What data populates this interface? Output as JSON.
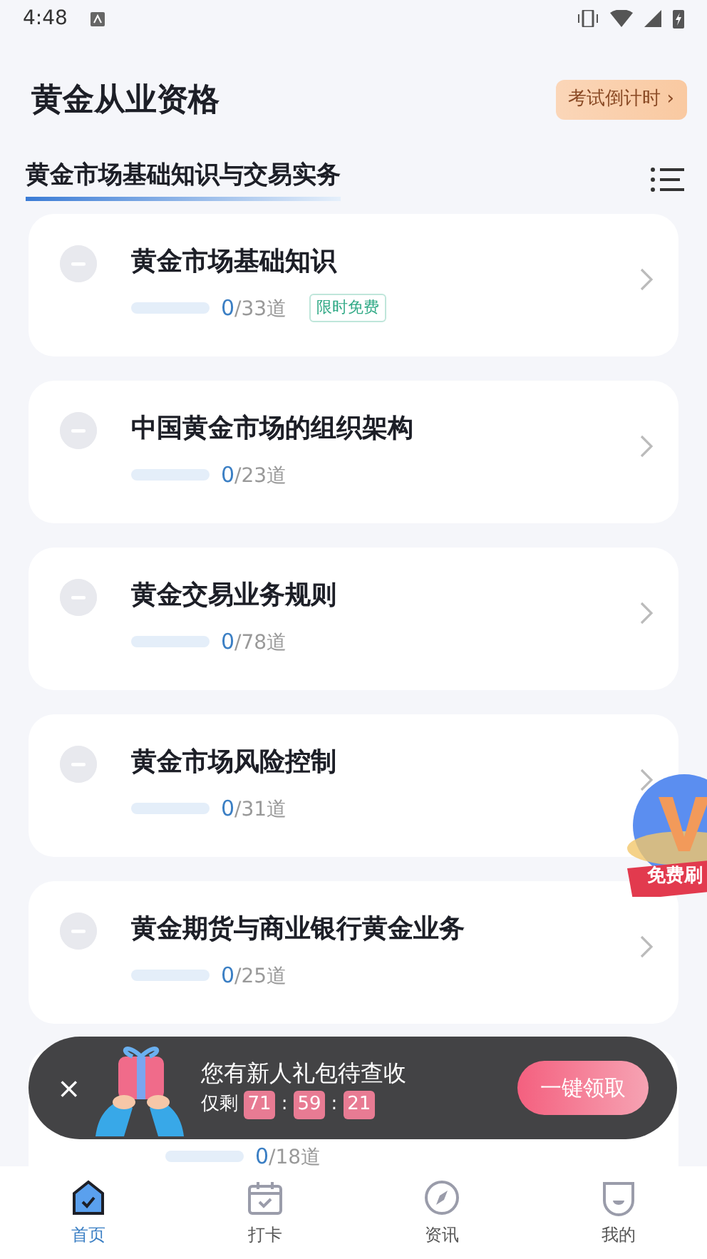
{
  "status_bar": {
    "time": "4:48"
  },
  "header": {
    "title": "黄金从业资格",
    "countdown_button": "考试倒计时 ›"
  },
  "section": {
    "title": "黄金市场基础知识与交易实务"
  },
  "chapters": [
    {
      "title": "黄金市场基础知识",
      "done": "0",
      "total": "/33道",
      "level": 0,
      "tag": "限时免费"
    },
    {
      "title": "中国黄金市场的组织架构",
      "done": "0",
      "total": "/23道",
      "level": 0
    },
    {
      "title": "黄金交易业务规则",
      "done": "0",
      "total": "/78道",
      "level": 0
    },
    {
      "title": "黄金市场风险控制",
      "done": "0",
      "total": "/31道",
      "level": 0
    },
    {
      "title": "黄金期货与商业银行黄金业务",
      "done": "0",
      "total": "/25道",
      "level": 0
    },
    {
      "done": "0",
      "total": "/18道",
      "level": 0
    }
  ],
  "float_badge": {
    "label": "免费刷"
  },
  "promo": {
    "close": "×",
    "title": "您有新人礼包待查收",
    "prefix": "仅剩",
    "timer": [
      "71",
      "59",
      "21"
    ],
    "separator": ":",
    "button": "一键领取"
  },
  "tabs": [
    {
      "label": "首页",
      "selected": true
    },
    {
      "label": "打卡",
      "selected": false
    },
    {
      "label": "资讯",
      "selected": false
    },
    {
      "label": "我的",
      "selected": false
    }
  ]
}
